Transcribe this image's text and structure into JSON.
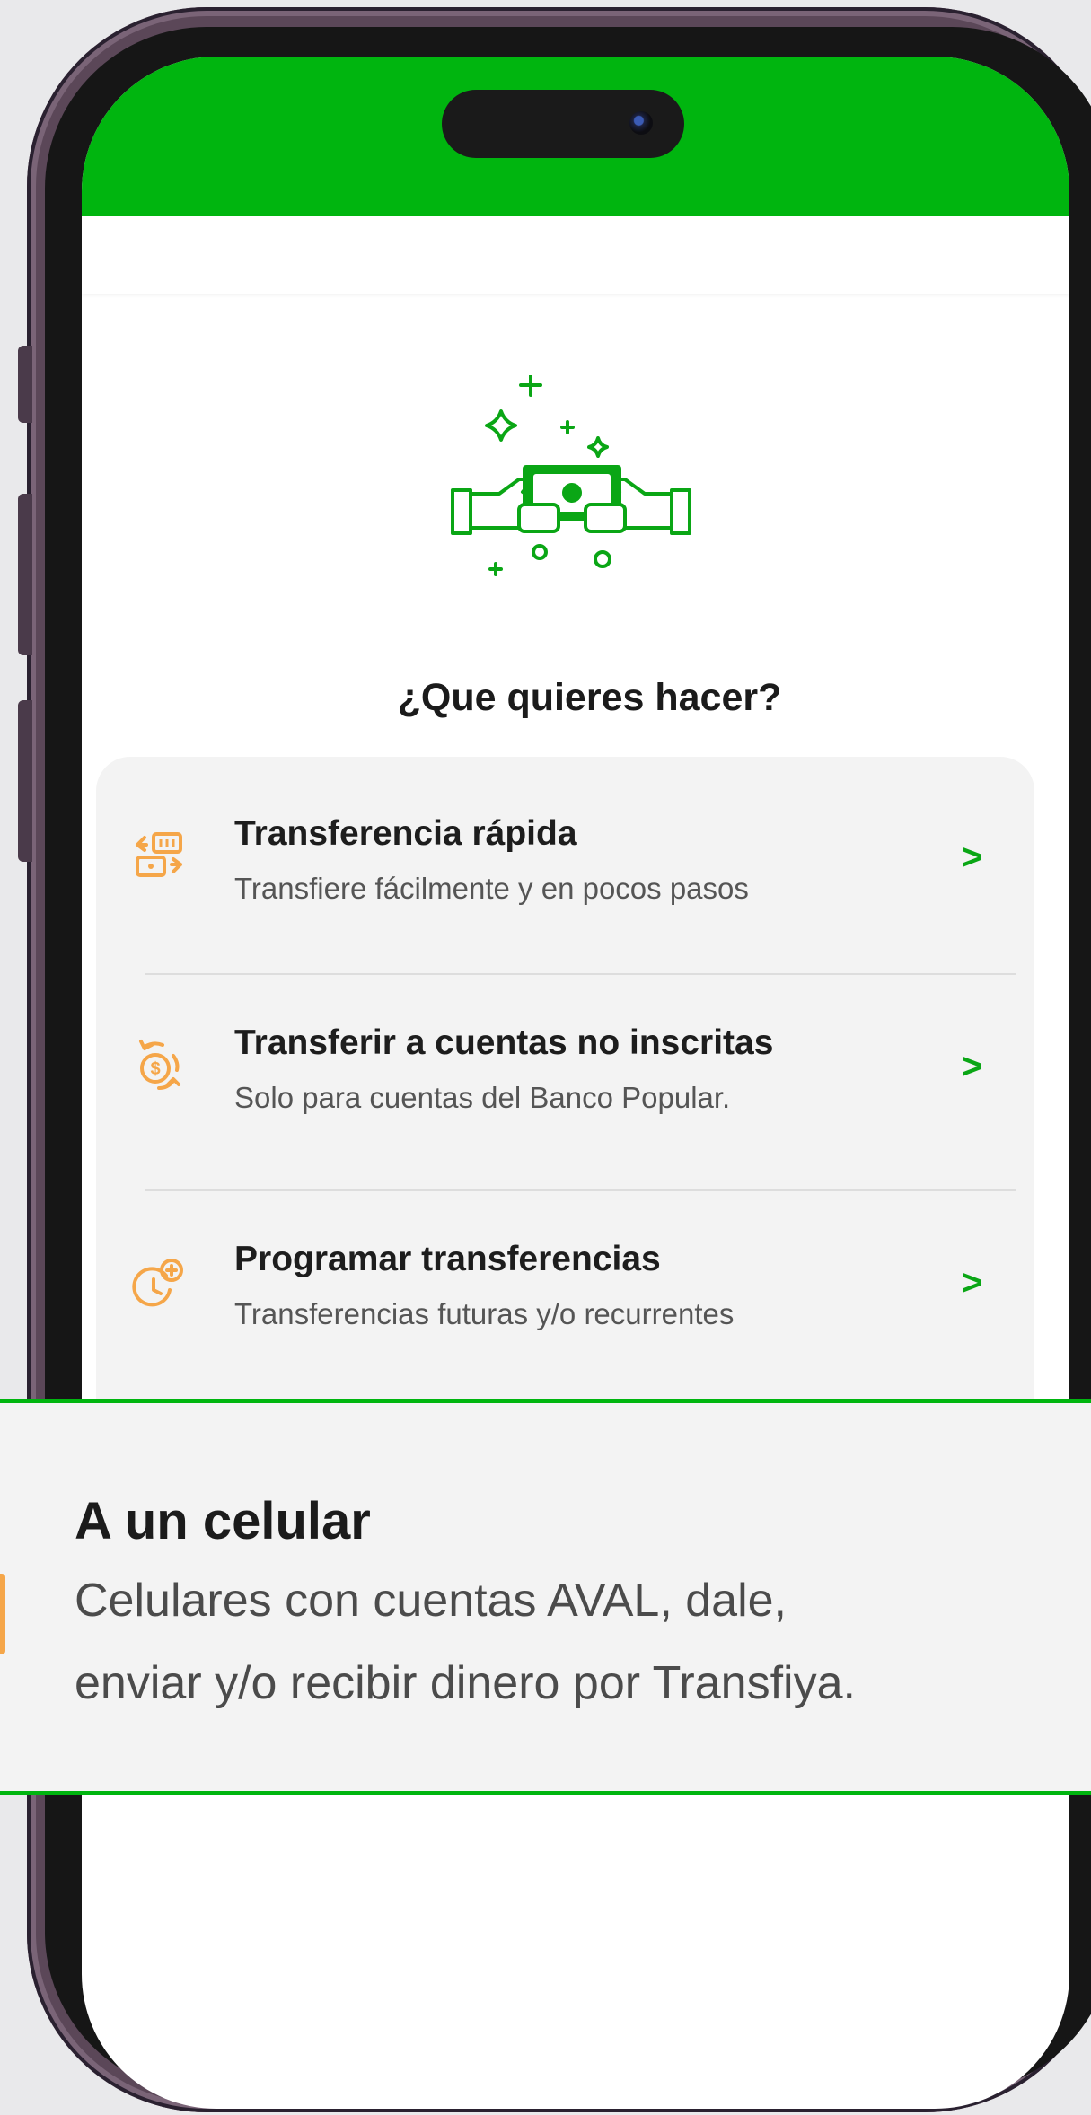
{
  "screen": {
    "title": "¿Que quieres hacer?"
  },
  "options": [
    {
      "title": "Transferencia rápida",
      "subtitle": "Transfiere fácilmente y en pocos pasos",
      "icon": "quick-transfer-icon"
    },
    {
      "title": "Transferir a cuentas no inscritas",
      "subtitle": "Solo para cuentas del Banco Popular.",
      "icon": "money-exchange-icon"
    },
    {
      "title": "Programar transferencias",
      "subtitle": "Transferencias futuras y/o recurrentes",
      "icon": "clock-plus-icon"
    }
  ],
  "chevron": ">",
  "highlight": {
    "title": "A un celular",
    "line1": "Celulares con cuentas AVAL, dale,",
    "line2": "enviar y/o recibir dinero por Transfiya."
  },
  "colors": {
    "brand_green": "#00b50f",
    "accent_orange": "#f5a649",
    "chevron_green": "#0aa615"
  }
}
